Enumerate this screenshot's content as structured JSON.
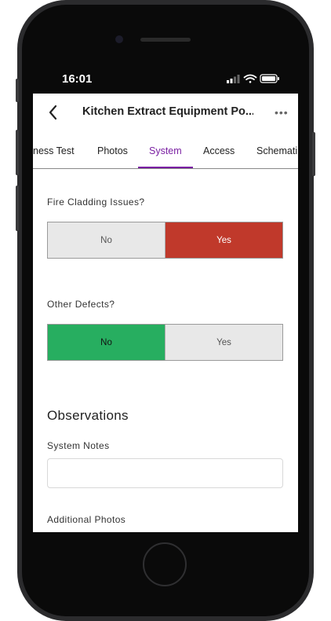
{
  "status_bar": {
    "time": "16:01"
  },
  "nav": {
    "title": "Kitchen Extract Equipment Po...",
    "more": "•••"
  },
  "tabs": [
    {
      "label": "ness Test"
    },
    {
      "label": "Photos"
    },
    {
      "label": "System"
    },
    {
      "label": "Access"
    },
    {
      "label": "Schemati"
    }
  ],
  "active_tab": "System",
  "questions": [
    {
      "label": "Fire Cladding Issues?",
      "options": [
        "No",
        "Yes"
      ],
      "selected": "Yes"
    },
    {
      "label": "Other Defects?",
      "options": [
        "No",
        "Yes"
      ],
      "selected": "No"
    }
  ],
  "observations": {
    "title": "Observations",
    "notes_label": "System Notes",
    "notes_value": "",
    "photos_label": "Additional Photos"
  },
  "colors": {
    "accent": "#7a1fa2",
    "yes_selected": "#c0392b",
    "no_selected": "#27ae60",
    "unselected": "#e8e8e8"
  }
}
